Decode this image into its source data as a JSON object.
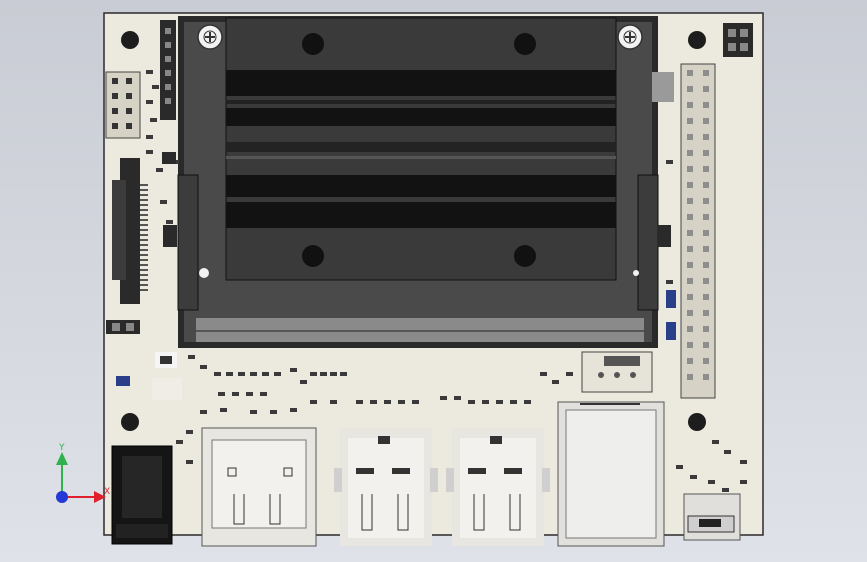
{
  "viewport": {
    "background_top": "#c9ccd4",
    "background_bottom": "#dfe2e8"
  },
  "colors": {
    "board": "#ece9de",
    "board_edge": "#2b2b2b",
    "heatsink": "#3a3a3a",
    "heatsink_dark": "#111111",
    "metal": "#cfcfcf",
    "connector": "#2a2a2a",
    "axis_x": "#e0202a",
    "axis_y": "#2fb24b",
    "axis_z": "#2438d6"
  },
  "axis": {
    "x_label": "X",
    "y_label": "Y"
  },
  "icons": {
    "mount_screw": "screw-icon",
    "mount_hole": "mounting-hole-icon",
    "coordinate_triad": "axis-triad-icon"
  }
}
